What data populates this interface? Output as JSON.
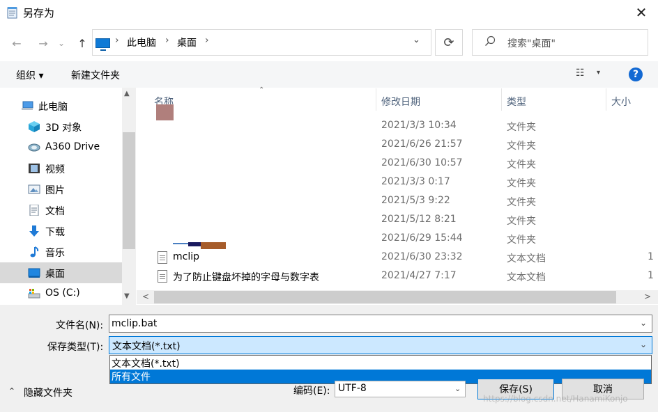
{
  "window": {
    "title": "另存为",
    "close_glyph": "✕"
  },
  "nav_buttons": {
    "back": "←",
    "forward": "→",
    "recent": "⌄",
    "up": "↑"
  },
  "address": {
    "crumbs": [
      "此电脑",
      "桌面"
    ],
    "sep": "›",
    "dropdown": "⌄",
    "refresh": "⟳"
  },
  "search": {
    "placeholder": "搜索\"桌面\""
  },
  "toolbar": {
    "organize": "组织 ▾",
    "new_folder": "新建文件夹",
    "view_glyph": "☷",
    "view_dd": "▾",
    "help": "?"
  },
  "sidebar": {
    "items": [
      {
        "label": "此电脑",
        "icon": "computer-icon"
      },
      {
        "label": "3D 对象",
        "icon": "3d-objects-icon"
      },
      {
        "label": "A360 Drive",
        "icon": "a360-drive-icon"
      },
      {
        "label": "视频",
        "icon": "video-icon"
      },
      {
        "label": "图片",
        "icon": "pictures-icon"
      },
      {
        "label": "文档",
        "icon": "documents-icon"
      },
      {
        "label": "下载",
        "icon": "downloads-icon"
      },
      {
        "label": "音乐",
        "icon": "music-icon"
      },
      {
        "label": "桌面",
        "icon": "desktop-icon",
        "selected": true
      },
      {
        "label": "OS (C:)",
        "icon": "drive-icon"
      }
    ],
    "scroll_up": "▲",
    "scroll_down": "▼"
  },
  "file_list": {
    "columns": {
      "name": "名称",
      "date": "修改日期",
      "type": "类型",
      "size": "大小"
    },
    "sort_arrow": "⌃",
    "rows": [
      {
        "name": "",
        "date": "2021/3/3 10:34",
        "type": "文件夹",
        "size": ""
      },
      {
        "name": "",
        "date": "2021/6/26 21:57",
        "type": "文件夹",
        "size": ""
      },
      {
        "name": "",
        "date": "2021/6/30 10:57",
        "type": "文件夹",
        "size": ""
      },
      {
        "name": "",
        "date": "2021/3/3 0:17",
        "type": "文件夹",
        "size": ""
      },
      {
        "name": "",
        "date": "2021/5/3 9:22",
        "type": "文件夹",
        "size": ""
      },
      {
        "name": "",
        "date": "2021/5/12 8:21",
        "type": "文件夹",
        "size": ""
      },
      {
        "name": "",
        "date": "2021/6/29 15:44",
        "type": "文件夹",
        "size": ""
      },
      {
        "name": "mclip",
        "date": "2021/6/30 23:32",
        "type": "文本文档",
        "size": "1"
      },
      {
        "name": "为了防止键盘坏掉的字母与数字表",
        "date": "2021/4/27 7:17",
        "type": "文本文档",
        "size": "1"
      }
    ],
    "scroll_left": "<",
    "scroll_right": ">"
  },
  "form": {
    "filename_label": "文件名(N):",
    "filename_value": "mclip.bat",
    "filetype_label": "保存类型(T):",
    "filetype_value": "文本文档(*.txt)",
    "filetype_options": [
      "文本文档(*.txt)",
      "所有文件"
    ],
    "dropdown_glyph": "⌄",
    "hide_folders_arrow": "⌃",
    "hide_folders": "隐藏文件夹",
    "encoding_label": "编码(E):",
    "encoding_value": "UTF-8",
    "save": "保存(S)",
    "cancel": "取消"
  },
  "watermark": "https://blog.csdn.net/HanamiKonjo",
  "colors": {
    "accent": "#0078d7",
    "selected_bg": "#cce8ff",
    "help": "#1269d3"
  }
}
